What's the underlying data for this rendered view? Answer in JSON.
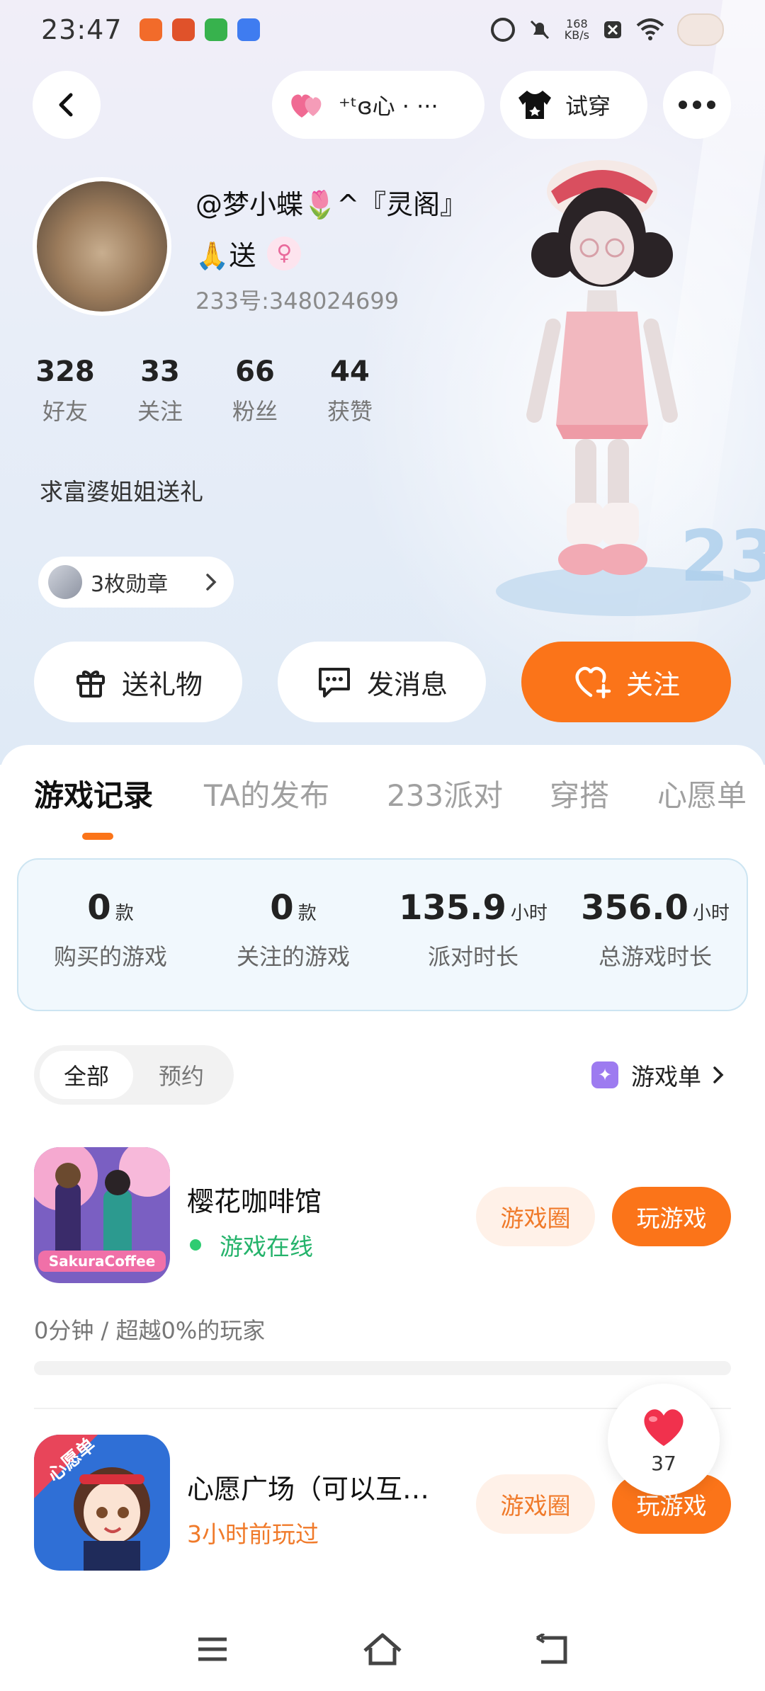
{
  "status_bar": {
    "time": "23:47",
    "net_speed_value": "168",
    "net_speed_unit": "KB/s",
    "apps": [
      "#f26b2a",
      "#e0522a",
      "#37b24d",
      "#3f7cf0"
    ]
  },
  "top_bar": {
    "back_icon": "chevron-left-icon",
    "relation_label": "⁺ᵗɞ心 · ···",
    "try_on_label": "试穿",
    "more_icon": "more-dots-icon"
  },
  "profile": {
    "username": "@梦小蝶🌷^『灵阁』",
    "username_line2": "🙏送",
    "gender_icon": "♀",
    "uid": "233号:348024699",
    "stats": [
      {
        "num": "328",
        "label": "好友"
      },
      {
        "num": "33",
        "label": "关注"
      },
      {
        "num": "66",
        "label": "粉丝"
      },
      {
        "num": "44",
        "label": "获赞"
      }
    ],
    "bio": "求富婆姐姐送礼",
    "medals": "3枚勋章"
  },
  "actions": {
    "gift": "送礼物",
    "message": "发消息",
    "follow": "关注"
  },
  "tabs": [
    {
      "label": "游戏记录",
      "active": true
    },
    {
      "label": "TA的发布",
      "active": false
    },
    {
      "label": "233派对",
      "active": false
    },
    {
      "label": "穿搭",
      "active": false
    },
    {
      "label": "心愿单",
      "active": false
    }
  ],
  "summary": [
    {
      "value": "0",
      "unit": "款",
      "label": "购买的游戏"
    },
    {
      "value": "0",
      "unit": "款",
      "label": "关注的游戏"
    },
    {
      "value": "135.9",
      "unit": "小时",
      "label": "派对时长"
    },
    {
      "value": "356.0",
      "unit": "小时",
      "label": "总游戏时长"
    }
  ],
  "filter": {
    "all": "全部",
    "reserve": "预约",
    "game_list": "游戏单"
  },
  "games": [
    {
      "name": "樱花咖啡馆",
      "status": "游戏在线",
      "status_color": "#25b36b",
      "circle_btn": "游戏圈",
      "play_btn": "玩游戏",
      "play_info": "0分钟 / 超越0%的玩家",
      "progress": 0
    },
    {
      "name": "心愿广场（可以互…",
      "status": "3小时前玩过",
      "status_color": "#f07a2a",
      "circle_btn": "游戏圈",
      "play_btn": "玩游戏"
    }
  ],
  "like_float": {
    "icon": "heart-icon",
    "count": "37"
  },
  "nav": {
    "menu_icon": "menu-icon",
    "home_icon": "home-icon",
    "back_icon": "back-icon"
  }
}
